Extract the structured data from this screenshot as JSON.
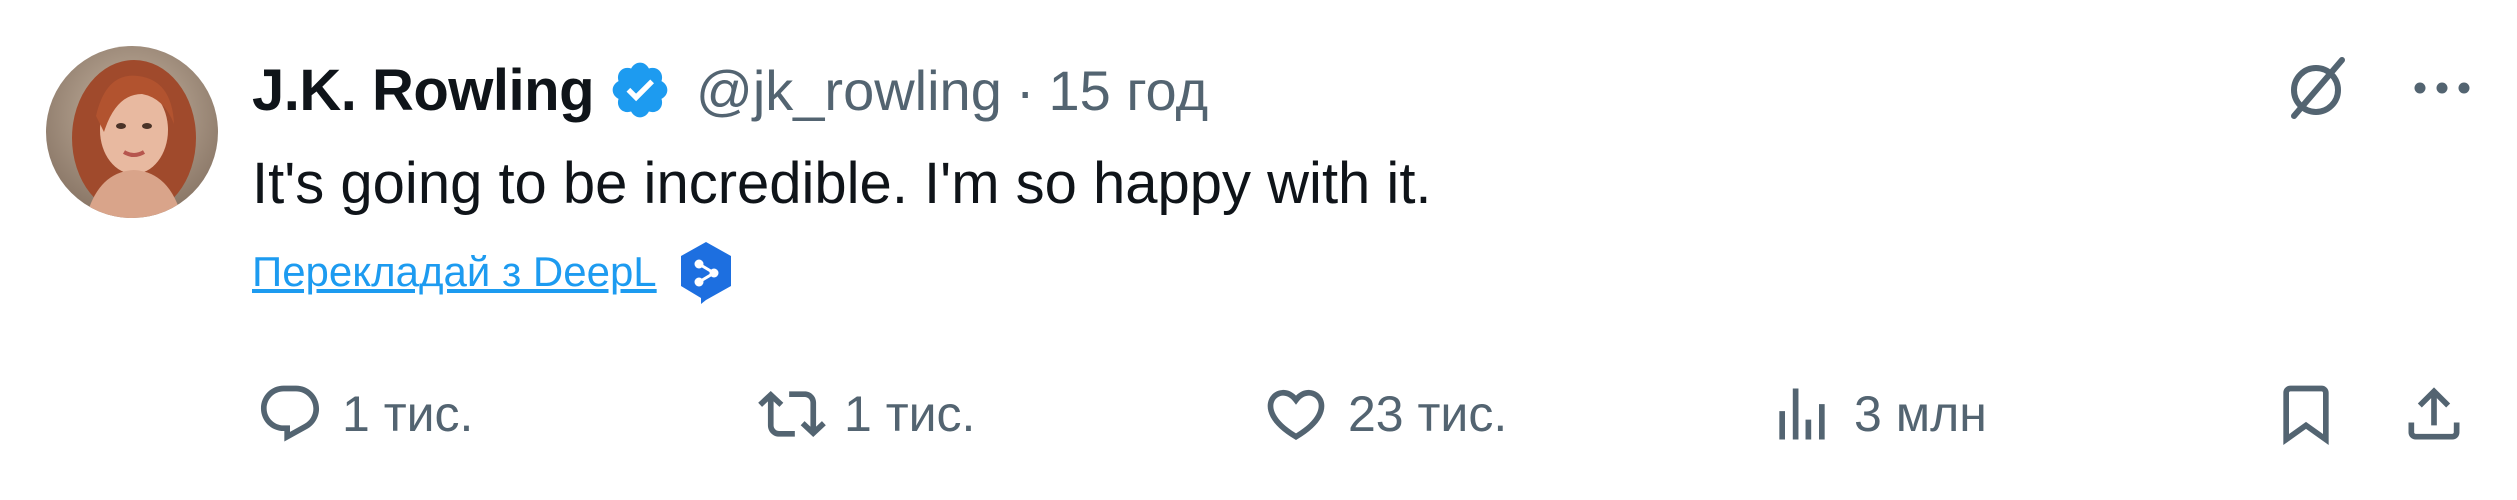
{
  "author": {
    "name": "J.K. Rowling",
    "handle": "@jk_rowling",
    "separator": "·",
    "time": "15 год",
    "avatar_icon": "author-avatar",
    "verified_icon": "verified-badge-icon"
  },
  "tweet": {
    "text": "It's going to be incredible. I'm so happy with it."
  },
  "translate": {
    "label": "Перекладай з DeepL",
    "icon": "deepl-icon"
  },
  "top_actions": {
    "grok_icon": "grok-icon",
    "more_icon": "more-icon"
  },
  "actions": {
    "reply": {
      "count": "1 тис.",
      "icon": "reply-icon"
    },
    "retweet": {
      "count": "1 тис.",
      "icon": "retweet-icon"
    },
    "like": {
      "count": "23 тис.",
      "icon": "heart-icon"
    },
    "views": {
      "count": "3 млн",
      "icon": "views-icon"
    },
    "bookmark": {
      "icon": "bookmark-icon"
    },
    "share": {
      "icon": "share-icon"
    }
  },
  "colors": {
    "text": "#0f1419",
    "secondary": "#536471",
    "accent": "#1d9bf0"
  }
}
